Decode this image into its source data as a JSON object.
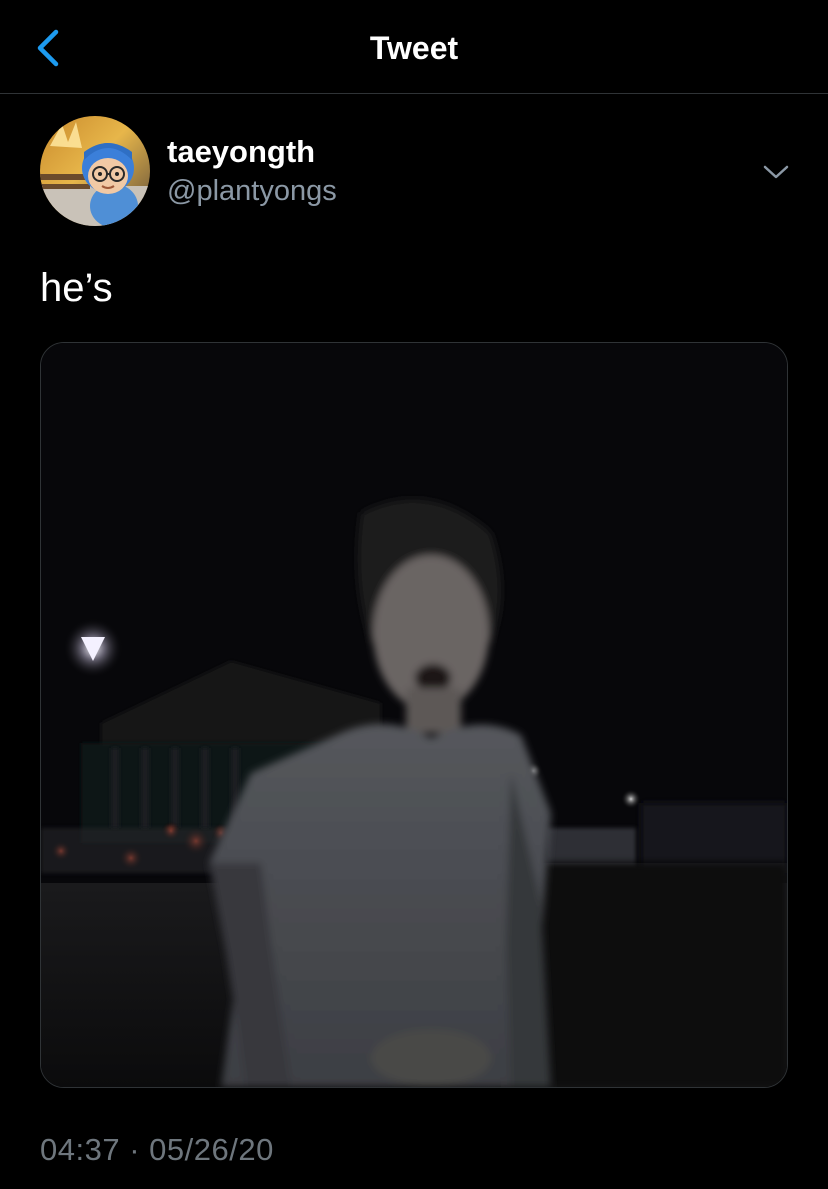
{
  "header": {
    "title": "Tweet",
    "back_icon": "chevron-left-icon"
  },
  "tweet": {
    "display_name": "taeyongth",
    "handle": "@plantyongs",
    "text": "he’s",
    "more_icon": "chevron-down-icon",
    "time": "04:37",
    "separator": "·",
    "date": "05/26/20"
  },
  "colors": {
    "background": "#000000",
    "accent": "#1d9bf0",
    "secondary_text": "#8b98a5",
    "divider": "#2f3336"
  }
}
